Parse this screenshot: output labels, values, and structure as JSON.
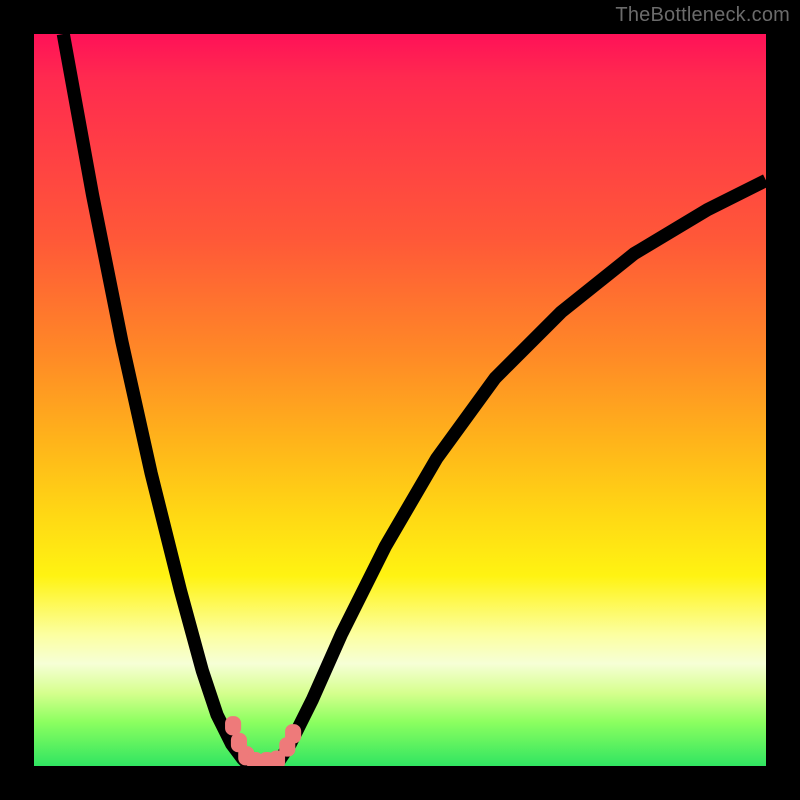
{
  "attribution": "TheBottleneck.com",
  "colors": {
    "frame": "#000000",
    "gradient_top": "#ff1158",
    "gradient_bottom": "#30e561",
    "curve": "#000000",
    "marker": "#ee7a7a"
  },
  "chart_data": {
    "type": "line",
    "title": "",
    "xlabel": "",
    "ylabel": "",
    "xlim": [
      0,
      100
    ],
    "ylim": [
      0,
      100
    ],
    "notes": "V-shaped bottleneck curve over rainbow gradient background. Values are approximate positions read from the plot in percent of axis range (0=left/bottom, 100=right/top).",
    "series": [
      {
        "name": "left-branch",
        "x": [
          4,
          8,
          12,
          16,
          20,
          23,
          25,
          27,
          28.5,
          29.5
        ],
        "y": [
          100,
          78,
          58,
          40,
          24,
          13,
          7,
          3,
          1,
          0
        ]
      },
      {
        "name": "right-branch",
        "x": [
          33,
          35,
          38,
          42,
          48,
          55,
          63,
          72,
          82,
          92,
          100
        ],
        "y": [
          0,
          3,
          9,
          18,
          30,
          42,
          53,
          62,
          70,
          76,
          80
        ]
      }
    ],
    "markers": {
      "name": "valley-markers",
      "points": [
        {
          "x": 27.2,
          "y": 5.5
        },
        {
          "x": 28.0,
          "y": 3.2
        },
        {
          "x": 29.0,
          "y": 1.4
        },
        {
          "x": 30.2,
          "y": 0.6
        },
        {
          "x": 31.8,
          "y": 0.6
        },
        {
          "x": 33.2,
          "y": 0.8
        },
        {
          "x": 34.6,
          "y": 2.6
        },
        {
          "x": 35.4,
          "y": 4.4
        }
      ],
      "radius_pct": 1.1
    }
  }
}
